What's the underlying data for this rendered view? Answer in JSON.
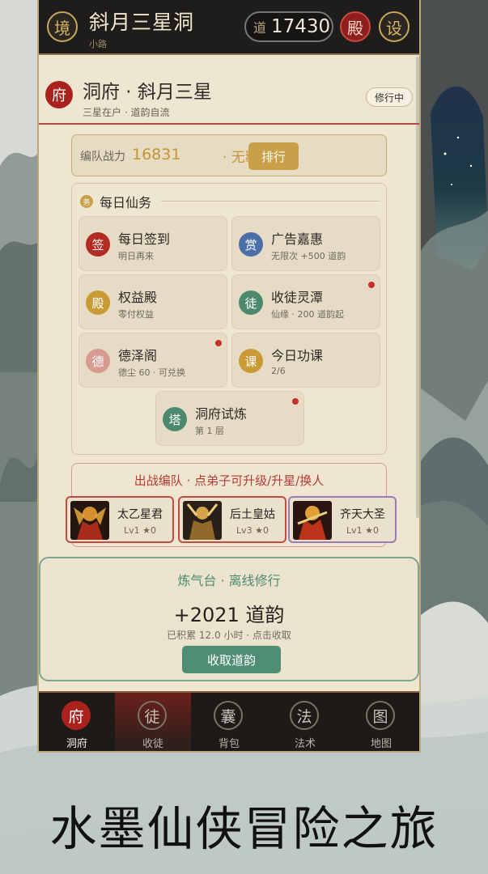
{
  "header": {
    "realm_icon": "境",
    "title": "斜月三星洞",
    "subtitle": "小路",
    "dao_label": "道",
    "dao_value": "17430",
    "hall_label": "殿",
    "settings_label": "设"
  },
  "cave": {
    "icon": "府",
    "title": "洞府 · 斜月三星",
    "subtitle": "三星在户 · 道韵自流",
    "status": "修行中"
  },
  "power": {
    "label": "编队战力",
    "value": "16831",
    "bond": "· 无羁绊",
    "rank_label": "排行"
  },
  "tasks": {
    "icon": "务",
    "title": "每日仙务",
    "items": [
      {
        "icon": "签",
        "name": "每日签到",
        "sub": "明日再来",
        "color": "#b42b24",
        "dot": false
      },
      {
        "icon": "赏",
        "name": "广告嘉惠",
        "sub": "无限次 +500 道韵",
        "color": "#4b6fa6",
        "dot": false
      },
      {
        "icon": "殿",
        "name": "权益殿",
        "sub": "零付权益",
        "color": "#c99a36",
        "dot": false
      },
      {
        "icon": "徒",
        "name": "收徒灵潭",
        "sub": "仙缘 · 200 道韵起",
        "color": "#4c8a70",
        "dot": true
      },
      {
        "icon": "德",
        "name": "德泽阁",
        "sub": "德尘 60 · 可兑换",
        "color": "#d79b91",
        "dot": true
      },
      {
        "icon": "课",
        "name": "今日功课",
        "sub": "2/6",
        "color": "#c99a36",
        "dot": false
      },
      {
        "icon": "塔",
        "name": "洞府试炼",
        "sub": "第 1 层",
        "color": "#4c8a70",
        "dot": true
      }
    ]
  },
  "team": {
    "title": "出战编队 · 点弟子可升级/升星/换人",
    "members": [
      {
        "name": "太乙星君",
        "level": "Lv1 ★0",
        "border": "red"
      },
      {
        "name": "后土皇姑",
        "level": "Lv3 ★0",
        "border": "red"
      },
      {
        "name": "齐天大圣",
        "level": "Lv1 ★0",
        "border": "purple"
      }
    ]
  },
  "offline": {
    "title": "炼气台 · 离线修行",
    "value": "+2021 道韵",
    "sub": "已积累 12.0 小时 · 点击收取",
    "button": "收取道韵"
  },
  "nav": [
    {
      "icon": "府",
      "label": "洞府"
    },
    {
      "icon": "徒",
      "label": "收徒"
    },
    {
      "icon": "囊",
      "label": "背包"
    },
    {
      "icon": "法",
      "label": "法术"
    },
    {
      "icon": "图",
      "label": "地图"
    }
  ],
  "slogan": "水墨仙侠冒险之旅",
  "colors": {
    "accent_red": "#a9221d",
    "gold": "#c9a048",
    "jade": "#4f8e75",
    "paper": "#efe6d1"
  }
}
